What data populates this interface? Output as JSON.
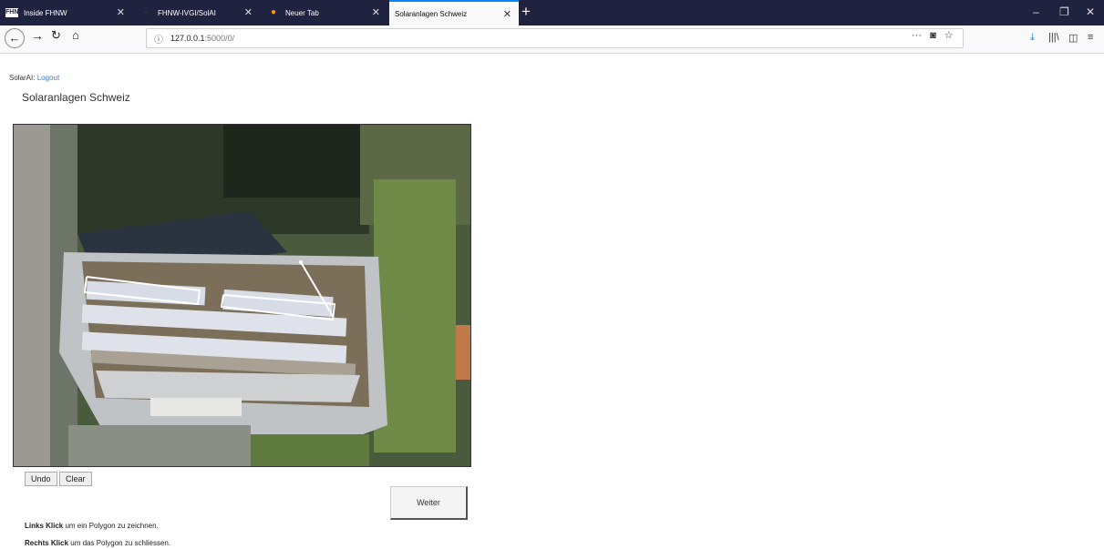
{
  "browser": {
    "tabs": [
      {
        "label": "Inside FHNW",
        "icon_text": "FHNW"
      },
      {
        "label": "FHNW-IVGI/SolAI"
      },
      {
        "label": "Neuer Tab"
      },
      {
        "label": "Solaranlagen Schweiz"
      }
    ],
    "url_host": "127.0.0.1",
    "url_rest": ":5000/0/"
  },
  "page": {
    "user_label": "SolarAI:",
    "logout_label": "Logout",
    "title": "Solaranlagen Schweiz",
    "undo_label": "Undo",
    "clear_label": "Clear",
    "next_label": "Weiter",
    "instruction_1_bold": "Links Klick",
    "instruction_1_text": " um ein Polygon zu zeichnen.",
    "instruction_2_bold": "Rechts Klick",
    "instruction_2_text": " um das Polygon zu schliessen."
  },
  "colors": {
    "tabbar": "#202340",
    "accent": "#0a84ff",
    "link": "#3d7fc4"
  }
}
